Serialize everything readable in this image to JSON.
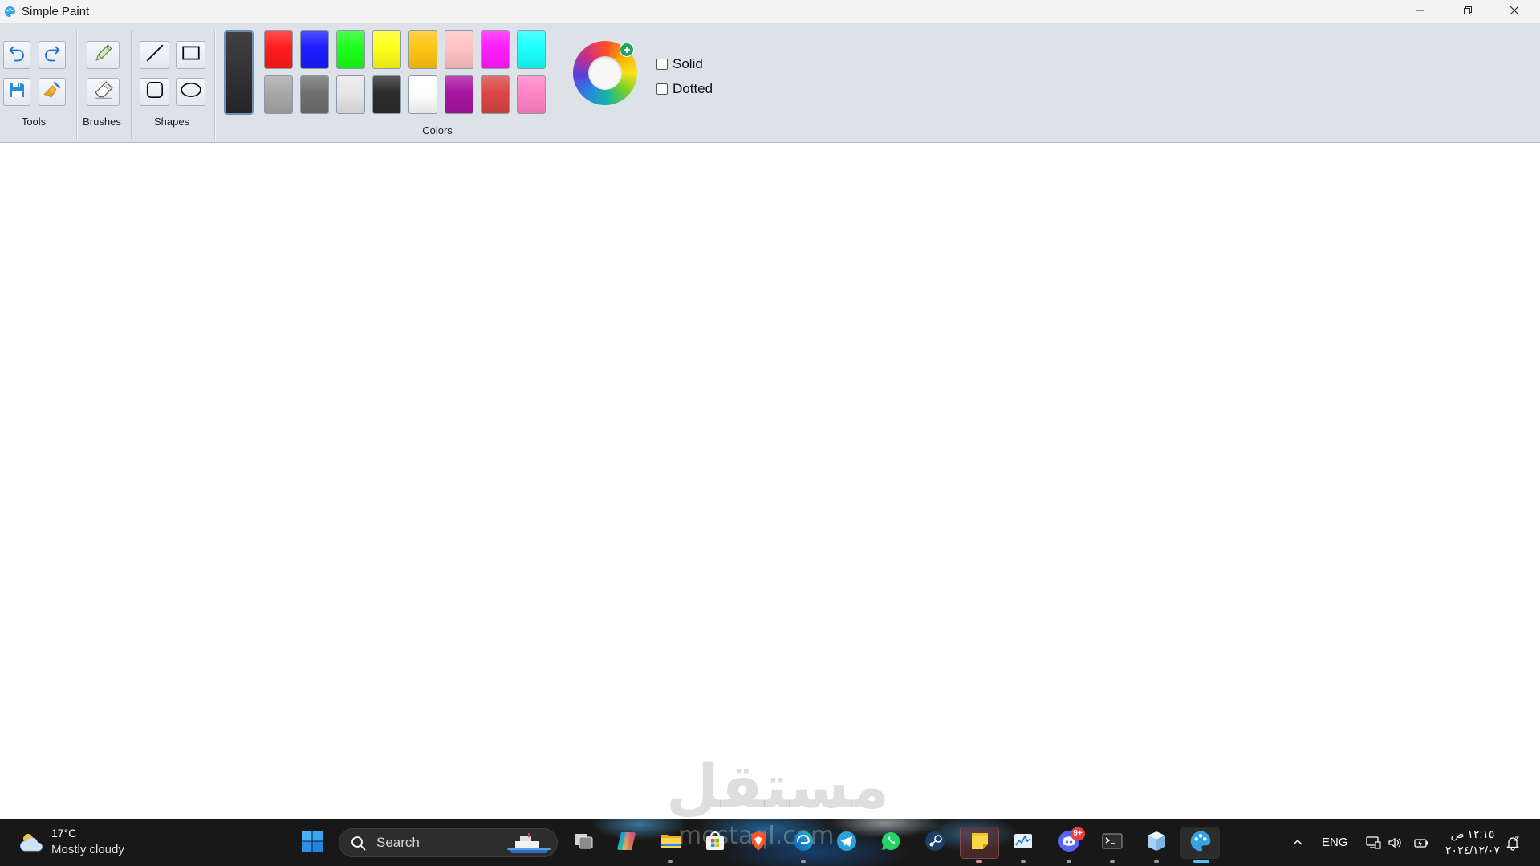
{
  "window": {
    "title": "Simple Paint",
    "icon": "paint-palette-icon",
    "controls": [
      "minimize-icon",
      "restore-icon",
      "close-icon"
    ]
  },
  "ribbon": {
    "groups": {
      "tools": "Tools",
      "brushes": "Brushes",
      "shapes": "Shapes",
      "colors": "Colors"
    },
    "tool_icons": [
      "undo-icon",
      "redo-icon",
      "save-icon",
      "broom-icon"
    ],
    "brush_icons": [
      "pencil-icon",
      "eraser-icon"
    ],
    "shape_icons": [
      "line-icon",
      "rectangle-icon",
      "rounded-rectangle-icon",
      "ellipse-icon"
    ],
    "current_color": "#2b2b2b",
    "palette": {
      "row1": [
        "#ff1c1c",
        "#1c1cff",
        "#1cff1c",
        "#ffff1c",
        "#ffc414",
        "#ffc2c2",
        "#ff1cff",
        "#1cffff"
      ],
      "row2": [
        "#a8a8a8",
        "#6f6f6f",
        "#e6e6e6",
        "#2b2b2b",
        "#ffffff",
        "#a616a0",
        "#d84646",
        "#ff84c6"
      ]
    },
    "custom_color_icon": "color-wheel-add-icon",
    "line_styles": [
      {
        "label": "Solid",
        "checked": false
      },
      {
        "label": "Dotted",
        "checked": false
      }
    ]
  },
  "watermark": {
    "arabic": "مستقل",
    "latin": "mostaql.com"
  },
  "taskbar": {
    "weather": {
      "icon": "partly-cloudy-icon",
      "temperature": "17°C",
      "condition": "Mostly cloudy"
    },
    "start_icon": "windows-start-icon",
    "search": {
      "icon": "search-icon",
      "placeholder": "Search"
    },
    "apps": [
      "task-view-icon",
      "copilot-icon",
      "file-explorer-icon",
      "microsoft-store-icon",
      "brave-browser-icon",
      "edge-browser-icon",
      "telegram-icon",
      "whatsapp-icon",
      "steam-icon",
      "sticky-notes-icon",
      "task-manager-icon",
      "discord-icon",
      "terminal-icon",
      "cube-app-icon",
      "simple-paint-icon"
    ],
    "discord_badge": "9+",
    "tray": {
      "icons": [
        "chevron-up-icon",
        "network-icon",
        "volume-icon",
        "battery-icon",
        "notification-bell-icon"
      ],
      "language": "ENG",
      "time": "١٢:١٥ ص",
      "date": "٢٠٢٤/١٢/٠٧"
    }
  }
}
